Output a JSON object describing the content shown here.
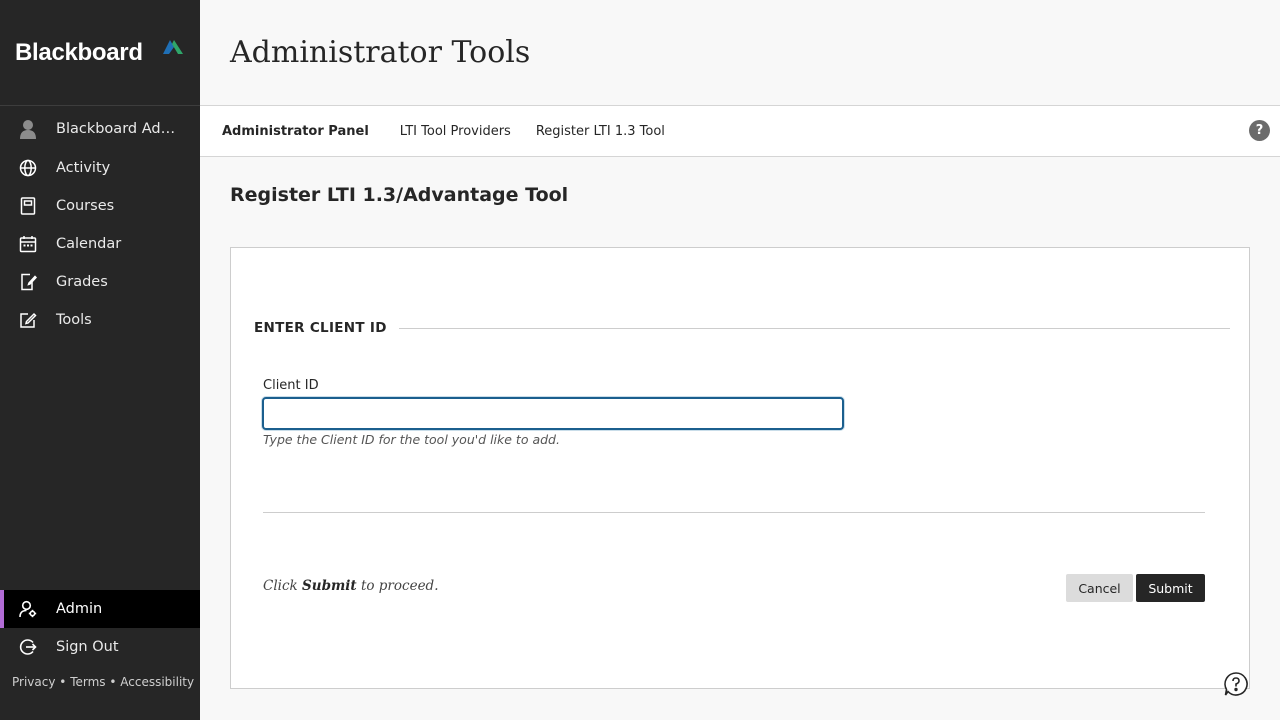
{
  "brand": {
    "name": "Blackboard",
    "accent_colors": [
      "#1f6fb5",
      "#2fa66a"
    ]
  },
  "sidebar": {
    "profile": {
      "label": "Blackboard Administrator",
      "icon": "avatar-icon"
    },
    "items": [
      {
        "label": "Activity",
        "icon": "globe-icon"
      },
      {
        "label": "Courses",
        "icon": "courses-icon"
      },
      {
        "label": "Calendar",
        "icon": "calendar-icon"
      },
      {
        "label": "Grades",
        "icon": "grades-icon"
      },
      {
        "label": "Tools",
        "icon": "tools-icon"
      }
    ],
    "bottom_items": [
      {
        "label": "Admin",
        "icon": "admin-icon",
        "active": true
      },
      {
        "label": "Sign Out",
        "icon": "sign-out-icon"
      }
    ],
    "footer": {
      "privacy": "Privacy",
      "terms": "Terms",
      "accessibility": "Accessibility",
      "separator": "•"
    },
    "active_accent": "#b26cd6"
  },
  "header": {
    "title": "Administrator Tools"
  },
  "breadcrumbs": [
    "Administrator Panel",
    "LTI Tool Providers",
    "Register LTI 1.3 Tool"
  ],
  "help_label": "?",
  "main": {
    "section_title": "Register LTI 1.3/Advantage Tool",
    "fieldset_legend": "ENTER CLIENT ID",
    "client_id": {
      "label": "Client ID",
      "value": "",
      "hint": "Type the Client ID for the tool you'd like to add."
    },
    "proceed": {
      "prefix": "Click ",
      "strong": "Submit",
      "suffix": " to proceed."
    },
    "buttons": {
      "cancel": "Cancel",
      "submit": "Submit"
    }
  }
}
